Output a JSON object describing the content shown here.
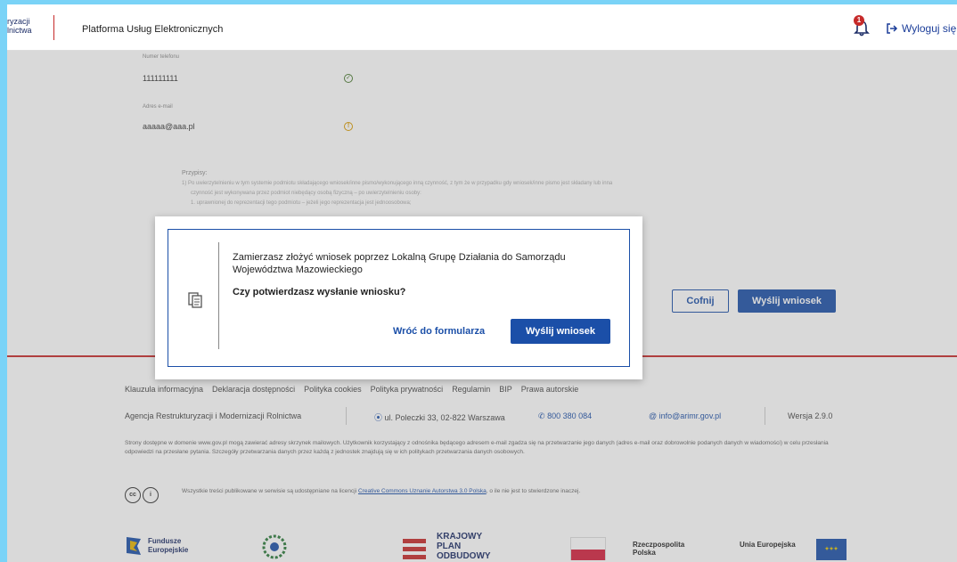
{
  "header": {
    "logo_line1": "ryzacji",
    "logo_line2": "lnictwa",
    "platform_title": "Platforma Usług Elektronicznych",
    "notification_count": "1",
    "logout_label": "Wyloguj się"
  },
  "form": {
    "phone_label": "Numer telefonu",
    "phone_value": "111111111",
    "email_label": "Adres e-mail",
    "email_value": "aaaaa@aaa.pl"
  },
  "notes": {
    "title": "Przypisy:",
    "lines": [
      "1) Po uwierzytelnieniu w tym systemie podmiotu składającego wniosek/inne pismo/wykonującego inną czynność, z tym że w przypadku gdy wniosek/inne pismo jest składany lub inna",
      "czynność jest wykonywana przez podmiot niebędący osobą fizyczną – po uwierzytelnieniu osoby:",
      "1. uprawnionej do reprezentacji tego podmiotu – jeżeli jego reprezentacja jest jednoosobowa;"
    ]
  },
  "page_buttons": {
    "back": "Cofnij",
    "submit": "Wyślij wniosek"
  },
  "footer": {
    "links": [
      "Klauzula informacyjna",
      "Deklaracja dostępności",
      "Polityka cookies",
      "Polityka prywatności",
      "Regulamin",
      "BIP",
      "Prawa autorskie"
    ],
    "agency": "Agencja Restrukturyzacji i Modernizacji Rolnictwa",
    "address": "ul. Poleczki 33, 02-822 Warszawa",
    "phone": "800 380 084",
    "email": "info@arimr.gov.pl",
    "version": "Wersja 2.9.0",
    "privacy_text": "Strony dostępne w domenie www.gov.pl mogą zawierać adresy skrzynek mailowych. Użytkownik korzystający z odnośnika będącego adresem e-mail zgadza się na przetwarzanie jego danych (adres e-mail oraz dobrowolnie podanych danych w wiadomości) w celu przesłania odpowiedzi na przesłane pytania. Szczegóły przetwarzania danych przez każdą z jednostek znajdują się w ich politykach przetwarzania danych osobowych.",
    "license_prefix": "Wszystkie treści publikowane w serwisie są udostępniane na licencji",
    "license_link": "Creative Commons Uznanie Autorstwa 3.0 Polska",
    "license_suffix": ", o ile nie jest to stwierdzone inaczej.",
    "logos": {
      "fe_line1": "Fundusze",
      "fe_line2": "Europejskie",
      "kpo_line1": "KRAJOWY",
      "kpo_line2": "PLAN",
      "kpo_line3": "ODBUDOWY",
      "rp_line1": "Rzeczpospolita",
      "rp_line2": "Polska",
      "ue_line1": "Unia Europejska"
    }
  },
  "modal": {
    "message": "Zamierzasz złożyć wniosek poprzez Lokalną Grupę Działania do Samorządu Województwa Mazowieckiego",
    "question": "Czy potwierdzasz wysłanie wniosku?",
    "back_label": "Wróć do formularza",
    "submit_label": "Wyślij wniosek"
  },
  "colors": {
    "primary": "#1b4fa8",
    "accent_red": "#c62a2a",
    "background_side": "#7ad3f7"
  }
}
